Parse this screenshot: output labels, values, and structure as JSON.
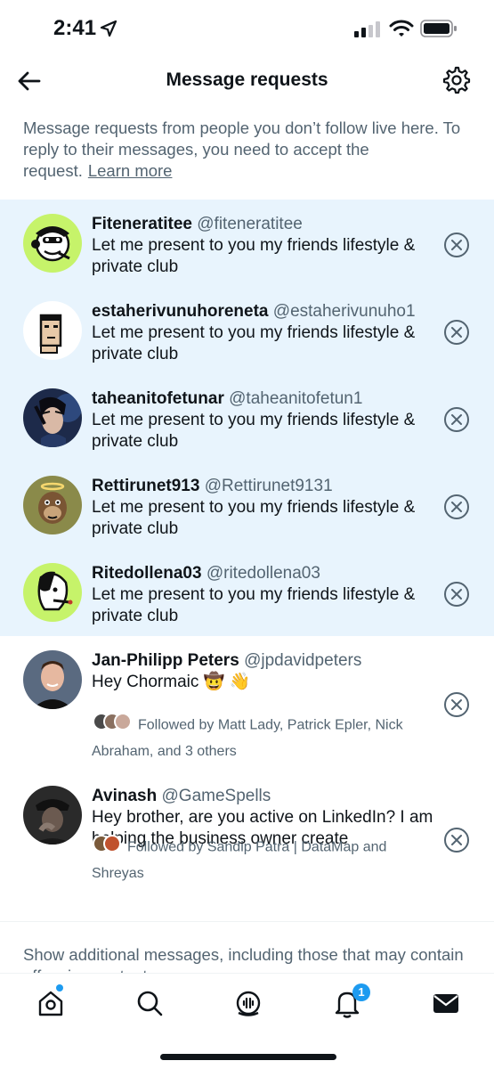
{
  "status_bar": {
    "time": "2:41"
  },
  "header": {
    "title": "Message requests"
  },
  "intro": {
    "text": "Message requests from people you don’t follow live here. To reply to their messages, you need to accept the request.",
    "learn_more": "Learn more"
  },
  "requests": [
    {
      "name": "Fiteneratitee",
      "handle": "@fiteneratitee",
      "message": "Let me present to you my friends lifestyle & private club"
    },
    {
      "name": "estaherivunuhoreneta",
      "handle": "@estaherivunuho1",
      "message": "Let me present to you my friends lifestyle & private club"
    },
    {
      "name": "taheanitofetunar",
      "handle": "@taheanitofetun1",
      "message": "Let me present to you my friends lifestyle & private club"
    },
    {
      "name": "Rettirunet913",
      "handle": "@Rettirunet9131",
      "message": "Let me present to you my friends lifestyle & private club"
    },
    {
      "name": "Ritedollena03",
      "handle": "@ritedollena03",
      "message": "Let me present to you my friends lifestyle & private club"
    }
  ],
  "conversations": [
    {
      "name": "Jan-Philipp Peters",
      "handle": "@jpdavidpeters",
      "message": "Hey Chormaic 🤠 👋",
      "followed_by": "Followed by Matt Lady, Patrick Epler, Nick Abraham, and 3 others"
    },
    {
      "name": "Avinash",
      "handle": "@GameSpells",
      "message": "Hey brother, are you active on LinkedIn? I am helping the business owner create",
      "followed_by": "Followed by Sandip Patra | DataMap and Shreyas"
    }
  ],
  "show_more": "Show additional messages, including those that may contain offensive content",
  "tabbar": {
    "notifications_badge": "1",
    "icons": [
      "home-icon",
      "search-icon",
      "spaces-icon",
      "notifications-icon",
      "messages-icon"
    ]
  },
  "colors": {
    "accent": "#1d9bf0",
    "request_bg": "#e8f4fd",
    "secondary_text": "#536471"
  }
}
